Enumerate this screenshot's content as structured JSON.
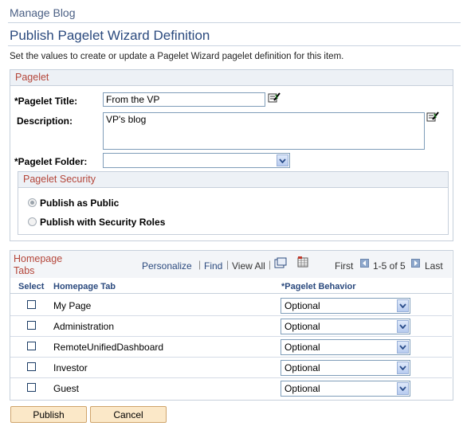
{
  "breadcrumb": "Manage Blog",
  "page_title": "Publish Pagelet Wizard Definition",
  "instructions": "Set the values to create or update a Pagelet Wizard pagelet definition for this item.",
  "pagelet_group": {
    "header": "Pagelet",
    "title_label": "*Pagelet Title:",
    "title_value": "From the VP",
    "description_label": "Description:",
    "description_value": "VP's blog",
    "folder_label": "*Pagelet Folder:",
    "folder_value": ""
  },
  "security_group": {
    "header": "Pagelet Security",
    "option_public": "Publish as Public",
    "option_roles": "Publish with Security Roles",
    "selected": "Publish as Public"
  },
  "homepage_tabs": {
    "header": "Homepage Tabs",
    "personalize": "Personalize",
    "find": "Find",
    "view_all": "View All",
    "first": "First",
    "range": "1-5 of 5",
    "last": "Last",
    "columns": [
      "Select",
      "Homepage Tab",
      "*Pagelet Behavior"
    ],
    "rows": [
      {
        "tab": "My Page",
        "behavior": "Optional"
      },
      {
        "tab": "Administration",
        "behavior": "Optional"
      },
      {
        "tab": "RemoteUnifiedDashboard",
        "behavior": "Optional"
      },
      {
        "tab": "Investor",
        "behavior": "Optional"
      },
      {
        "tab": "Guest",
        "behavior": "Optional"
      }
    ]
  },
  "buttons": {
    "publish": "Publish",
    "cancel": "Cancel"
  },
  "colors": {
    "title": "#2b4a7e",
    "group_header_text": "#b4463a",
    "button_bg": "#fbe8c8"
  }
}
